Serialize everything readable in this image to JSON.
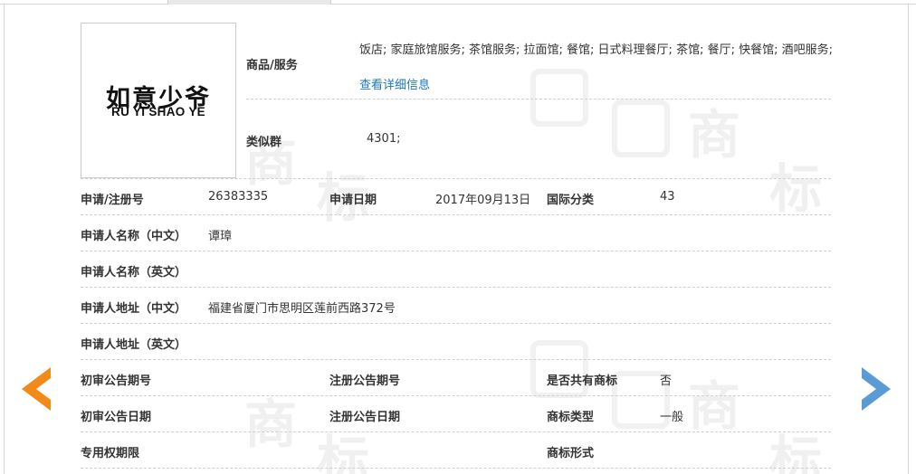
{
  "logo": {
    "cn": "如意少爷",
    "en": "RU YI SHAO YE"
  },
  "goods_services": {
    "label": "商品/服务",
    "text": "饭店; 家庭旅馆服务; 茶馆服务; 拉面馆; 餐馆; 日式料理餐厅; 茶馆; 餐厅; 快餐馆; 酒吧服务;",
    "detail_link": "查看详细信息"
  },
  "similar_group": {
    "label": "类似群",
    "value": "4301;"
  },
  "fields": {
    "reg_no_label": "申请/注册号",
    "reg_no_value": "26383335",
    "apply_date_label": "申请日期",
    "apply_date_value": "2017年09月13日",
    "intl_class_label": "国际分类",
    "intl_class_value": "43",
    "applicant_cn_label": "申请人名称（中文）",
    "applicant_cn_value": "谭璋",
    "applicant_en_label": "申请人名称（英文）",
    "applicant_en_value": "",
    "address_cn_label": "申请人地址（中文）",
    "address_cn_value": "福建省厦门市思明区莲前西路372号",
    "address_en_label": "申请人地址（英文）",
    "address_en_value": "",
    "prelim_pub_no_label": "初审公告期号",
    "prelim_pub_no_value": "",
    "reg_pub_no_label": "注册公告期号",
    "reg_pub_no_value": "",
    "shared_label": "是否共有商标",
    "shared_value": "否",
    "prelim_pub_date_label": "初审公告日期",
    "prelim_pub_date_value": "",
    "reg_pub_date_label": "注册公告日期",
    "reg_pub_date_value": "",
    "tm_type_label": "商标类型",
    "tm_type_value": "一般",
    "exclusive_period_label": "专用权期限",
    "exclusive_period_value": "",
    "tm_form_label": "商标形式",
    "tm_form_value": ""
  },
  "colors": {
    "link": "#1a78c2",
    "prev_arrow": "#f28a1a",
    "next_arrow": "#5b9bd5"
  },
  "icons": {
    "prev": "arrow-left-icon",
    "next": "arrow-right-icon"
  }
}
